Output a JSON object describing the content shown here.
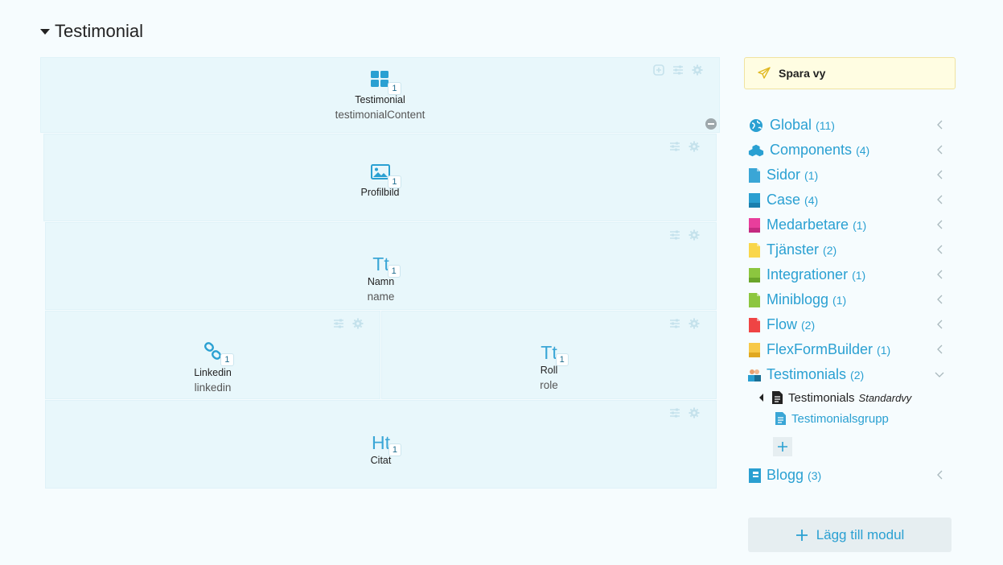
{
  "section": {
    "title": "Testimonial"
  },
  "canvas": {
    "blocks": {
      "testimonial": {
        "label": "Testimonial",
        "key": "testimonialContent",
        "count": "1"
      },
      "profilbild": {
        "label": "Profilbild",
        "count": "1"
      },
      "namn": {
        "icon_text": "Tt",
        "label": "Namn",
        "key": "name",
        "count": "1"
      },
      "linkedin": {
        "label": "Linkedin",
        "key": "linkedin",
        "count": "1"
      },
      "roll": {
        "icon_text": "Tt",
        "label": "Roll",
        "key": "role",
        "count": "1"
      },
      "citat": {
        "icon_text": "Ht",
        "label": "Citat",
        "count": "1"
      }
    }
  },
  "sidebar": {
    "save_label": "Spara vy",
    "modules": [
      {
        "name": "Global",
        "count": "(11)",
        "icon": "globe-icon",
        "color": "#2aa0d2"
      },
      {
        "name": "Components",
        "count": "(4)",
        "icon": "cubes-icon",
        "color": "#2aa0d2"
      },
      {
        "name": "Sidor",
        "count": "(1)",
        "icon": "page-icon",
        "color": "#3aa6d6"
      },
      {
        "name": "Case",
        "count": "(4)",
        "icon": "page-icon",
        "color": "#2a9fd1"
      },
      {
        "name": "Medarbetare",
        "count": "(1)",
        "icon": "page-icon",
        "color": "#e83e9c"
      },
      {
        "name": "Tjänster",
        "count": "(2)",
        "icon": "page-icon",
        "color": "#f9d64a"
      },
      {
        "name": "Integrationer",
        "count": "(1)",
        "icon": "page-icon",
        "color": "#8cc63f"
      },
      {
        "name": "Miniblogg",
        "count": "(1)",
        "icon": "page-icon",
        "color": "#8cc63f"
      },
      {
        "name": "Flow",
        "count": "(2)",
        "icon": "page-icon",
        "color": "#ef4444"
      },
      {
        "name": "FlexFormBuilder",
        "count": "(1)",
        "icon": "page-icon",
        "color": "#f7c948"
      },
      {
        "name": "Testimonials",
        "count": "(2)",
        "icon": "people-icon",
        "color": "#e9a070"
      },
      {
        "name": "Blogg",
        "count": "(3)",
        "icon": "book-icon",
        "color": "#2a9fd1"
      }
    ],
    "testimonials_sub": {
      "view_name": "Testimonials",
      "view_tag": "Standardvy",
      "group_name": "Testimonialsgrupp"
    },
    "add_module_label": "Lägg till modul"
  }
}
